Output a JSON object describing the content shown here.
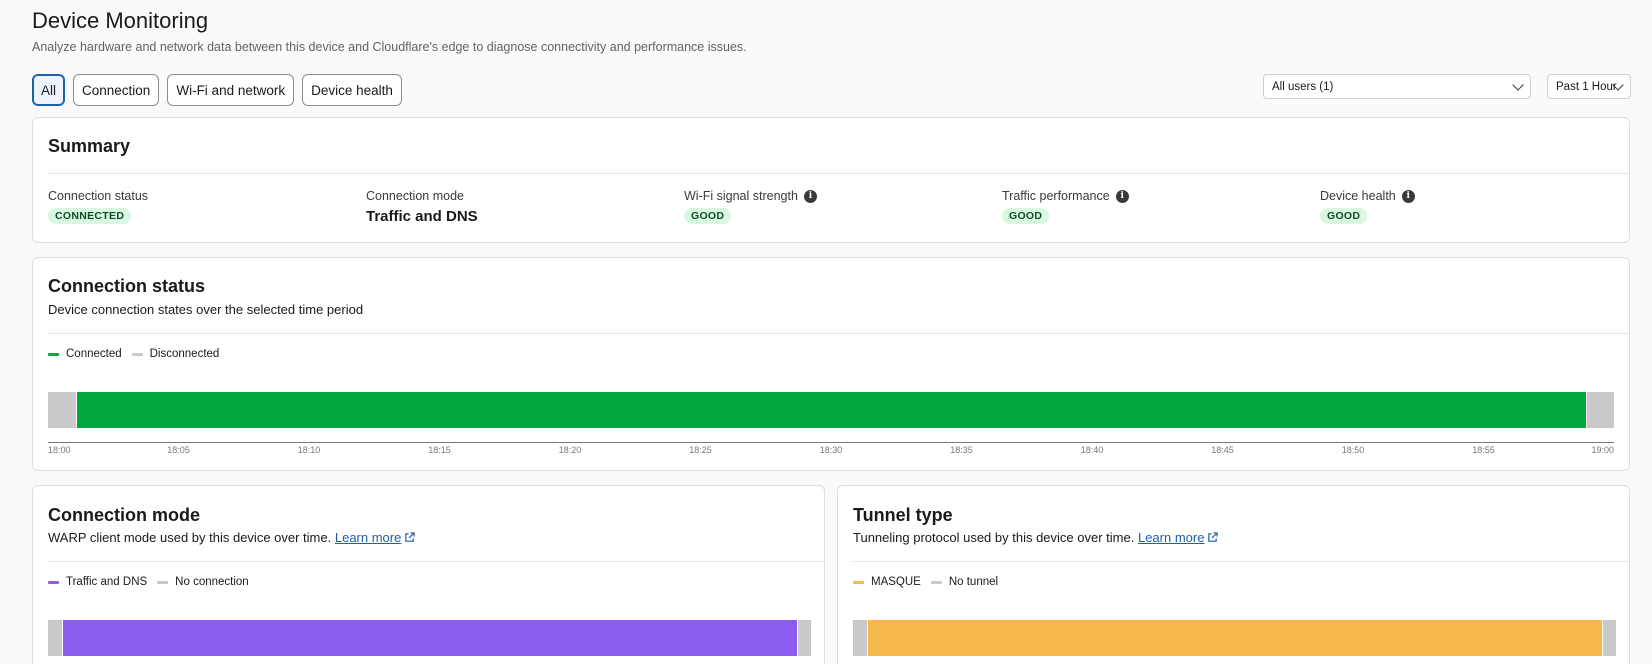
{
  "header": {
    "title": "Device Monitoring",
    "subtitle": "Analyze hardware and network data between this device and Cloudflare's edge to diagnose connectivity and performance issues."
  },
  "tabs": [
    {
      "label": "All",
      "active": true
    },
    {
      "label": "Connection",
      "active": false
    },
    {
      "label": "Wi-Fi and network",
      "active": false
    },
    {
      "label": "Device health",
      "active": false
    }
  ],
  "filters": {
    "users": "All users (1)",
    "time_range": "Past 1 Hour"
  },
  "summary": {
    "title": "Summary",
    "items": [
      {
        "label": "Connection status",
        "value": "CONNECTED",
        "kind": "badge",
        "info": false
      },
      {
        "label": "Connection mode",
        "value": "Traffic and DNS",
        "kind": "text",
        "info": false
      },
      {
        "label": "Wi-Fi signal strength",
        "value": "GOOD",
        "kind": "badge",
        "info": true
      },
      {
        "label": "Traffic performance",
        "value": "GOOD",
        "kind": "badge",
        "info": true
      },
      {
        "label": "Device health",
        "value": "GOOD",
        "kind": "badge",
        "info": true
      }
    ]
  },
  "connection_status": {
    "title": "Connection status",
    "description": "Device connection states over the selected time period",
    "legend": [
      {
        "label": "Connected",
        "color": "#00a63e"
      },
      {
        "label": "Disconnected",
        "color": "#c9c9c9"
      }
    ],
    "segments": [
      {
        "state": "Disconnected",
        "share": 0.018,
        "color": "#c9c9c9"
      },
      {
        "state": "Connected",
        "share": 0.965,
        "color": "#00a63e"
      },
      {
        "state": "Disconnected",
        "share": 0.017,
        "color": "#c9c9c9"
      }
    ],
    "ticks": [
      "18:00",
      "18:05",
      "18:10",
      "18:15",
      "18:20",
      "18:25",
      "18:30",
      "18:35",
      "18:40",
      "18:45",
      "18:50",
      "18:55",
      "19:00"
    ]
  },
  "connection_mode": {
    "title": "Connection mode",
    "description": "WARP client mode used by this device over time.",
    "link": "Learn more",
    "legend": [
      {
        "label": "Traffic and DNS",
        "color": "#8c5cf0"
      },
      {
        "label": "No connection",
        "color": "#c9c9c9"
      }
    ],
    "segments": [
      {
        "state": "No connection",
        "share": 0.018,
        "color": "#c9c9c9"
      },
      {
        "state": "Traffic and DNS",
        "share": 0.965,
        "color": "#8c5cf0"
      },
      {
        "state": "No connection",
        "share": 0.017,
        "color": "#c9c9c9"
      }
    ]
  },
  "tunnel_type": {
    "title": "Tunnel type",
    "description": "Tunneling protocol used by this device over time.",
    "link": "Learn more",
    "legend": [
      {
        "label": "MASQUE",
        "color": "#f6b74c"
      },
      {
        "label": "No tunnel",
        "color": "#c9c9c9"
      }
    ],
    "segments": [
      {
        "state": "No tunnel",
        "share": 0.018,
        "color": "#c9c9c9"
      },
      {
        "state": "MASQUE",
        "share": 0.965,
        "color": "#f6b74c"
      },
      {
        "state": "No tunnel",
        "share": 0.017,
        "color": "#c9c9c9"
      }
    ]
  }
}
